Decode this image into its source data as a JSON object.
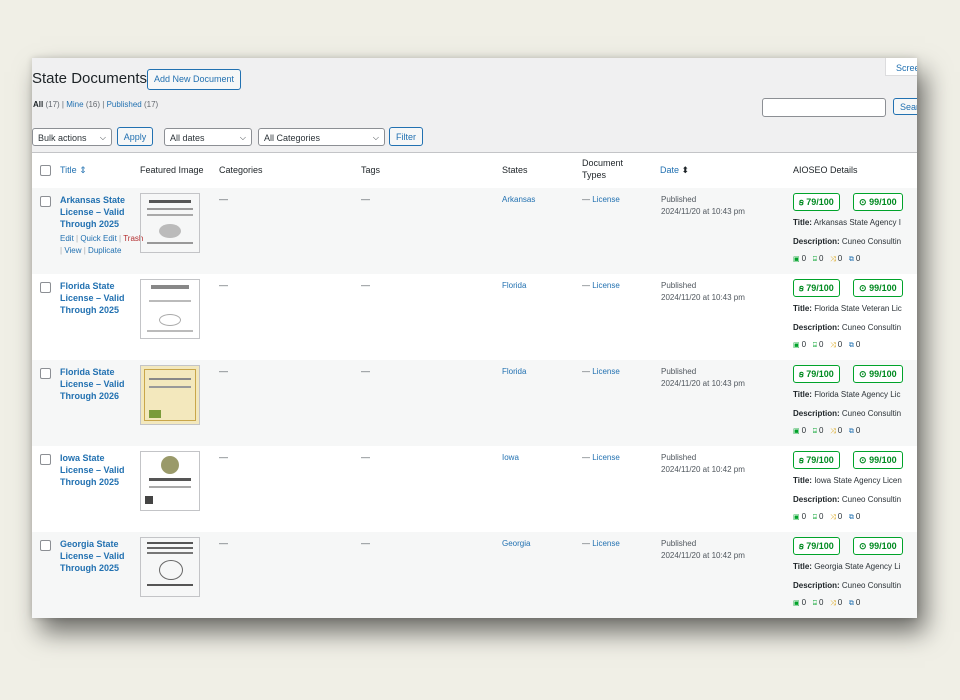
{
  "page": {
    "title": "State Documents",
    "add_new": "Add New Document",
    "screen_options": "Scree",
    "search_button": "Sear",
    "views": {
      "all": "All",
      "all_count": "(17)",
      "mine": "Mine",
      "mine_count": "(16)",
      "published": "Published",
      "published_count": "(17)"
    },
    "filters": {
      "bulk_actions": "Bulk actions",
      "apply": "Apply",
      "all_dates": "All dates",
      "all_categories": "All Categories",
      "filter": "Filter"
    }
  },
  "columns": {
    "title": "Title",
    "featured_image": "Featured Image",
    "categories": "Categories",
    "tags": "Tags",
    "states": "States",
    "document_types": "Document Types",
    "date": "Date",
    "aioseo": "AIOSEO Details"
  },
  "row_actions": {
    "edit": "Edit",
    "quick_edit": "Quick Edit",
    "trash": "Trash",
    "view": "View",
    "duplicate": "Duplicate"
  },
  "labels": {
    "dash": "—",
    "title": "Title:",
    "description": "Description:"
  },
  "rows": [
    {
      "title": "Arkansas State License – Valid Through 2025",
      "state": "Arkansas",
      "doc_type": "License",
      "status": "Published",
      "date": "2024/11/20 at 10:43 pm",
      "score1": "79/100",
      "score2": "99/100",
      "seo_title": "Arkansas State Agency I",
      "seo_desc": "Cuneo Consultin",
      "stats": [
        "0",
        "0",
        "0",
        "0"
      ]
    },
    {
      "title": "Florida State License – Valid Through 2025",
      "state": "Florida",
      "doc_type": "License",
      "status": "Published",
      "date": "2024/11/20 at 10:43 pm",
      "score1": "79/100",
      "score2": "99/100",
      "seo_title": "Florida State Veteran Lic",
      "seo_desc": "Cuneo Consultin",
      "stats": [
        "0",
        "0",
        "0",
        "0"
      ]
    },
    {
      "title": "Florida State License – Valid Through 2026",
      "state": "Florida",
      "doc_type": "License",
      "status": "Published",
      "date": "2024/11/20 at 10:43 pm",
      "score1": "79/100",
      "score2": "99/100",
      "seo_title": "Florida State Agency Lic",
      "seo_desc": "Cuneo Consultin",
      "stats": [
        "0",
        "0",
        "0",
        "0"
      ]
    },
    {
      "title": "Iowa State License – Valid Through 2025",
      "state": "Iowa",
      "doc_type": "License",
      "status": "Published",
      "date": "2024/11/20 at 10:42 pm",
      "score1": "79/100",
      "score2": "99/100",
      "seo_title": "Iowa State Agency Licen",
      "seo_desc": "Cuneo Consultin",
      "stats": [
        "0",
        "0",
        "0",
        "0"
      ]
    },
    {
      "title": "Georgia State License – Valid Through 2025",
      "state": "Georgia",
      "doc_type": "License",
      "status": "Published",
      "date": "2024/11/20 at 10:42 pm",
      "score1": "79/100",
      "score2": "99/100",
      "seo_title": "Georgia State Agency Li",
      "seo_desc": "Cuneo Consultin",
      "stats": [
        "0",
        "0",
        "0",
        "0"
      ]
    }
  ]
}
